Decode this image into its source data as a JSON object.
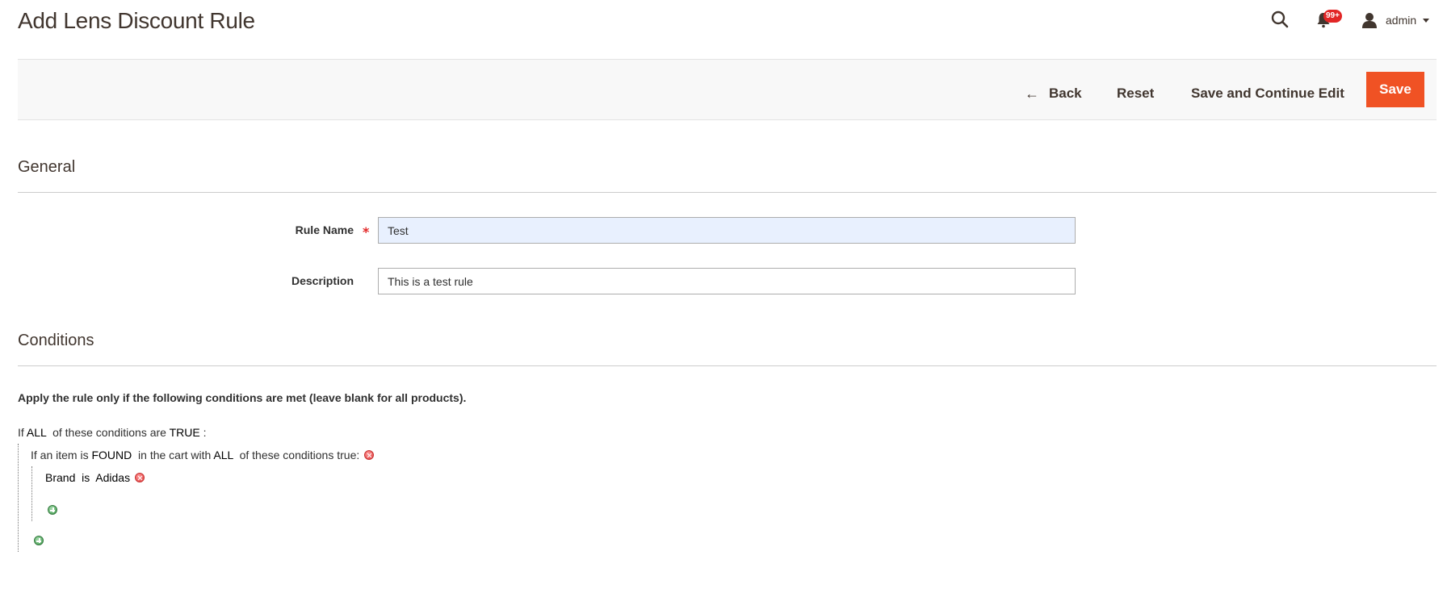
{
  "page": {
    "title": "Add Lens Discount Rule"
  },
  "header": {
    "search_icon": "search-icon",
    "notifications": {
      "icon": "bell-icon",
      "badge": "99+"
    },
    "user": {
      "icon": "user-icon",
      "name": "admin"
    }
  },
  "toolbar": {
    "back_label": "Back",
    "back_icon": "←",
    "reset_label": "Reset",
    "save_continue_label": "Save and Continue Edit",
    "save_label": "Save"
  },
  "general": {
    "title": "General",
    "rule_name": {
      "label": "Rule Name",
      "required": "*",
      "value": "Test"
    },
    "description": {
      "label": "Description",
      "value": "This is a test rule"
    }
  },
  "conditions": {
    "title": "Conditions",
    "intro": "Apply the rule only if the following conditions are met (leave blank for all products).",
    "root": {
      "prefix": "If ",
      "aggregator": "ALL",
      "middle": "  of these conditions are ",
      "value": "TRUE",
      "suffix": " :"
    },
    "found": {
      "prefix": "If an item is ",
      "found": "FOUND",
      "middle": "  in the cart with ",
      "aggregator": "ALL",
      "suffix": "  of these conditions true: "
    },
    "brand": {
      "attribute": "Brand",
      "operator": "is",
      "value": "Adidas"
    }
  },
  "colors": {
    "accent": "#f05224",
    "required": "#e22626",
    "autofill": "#e8f0fe"
  }
}
